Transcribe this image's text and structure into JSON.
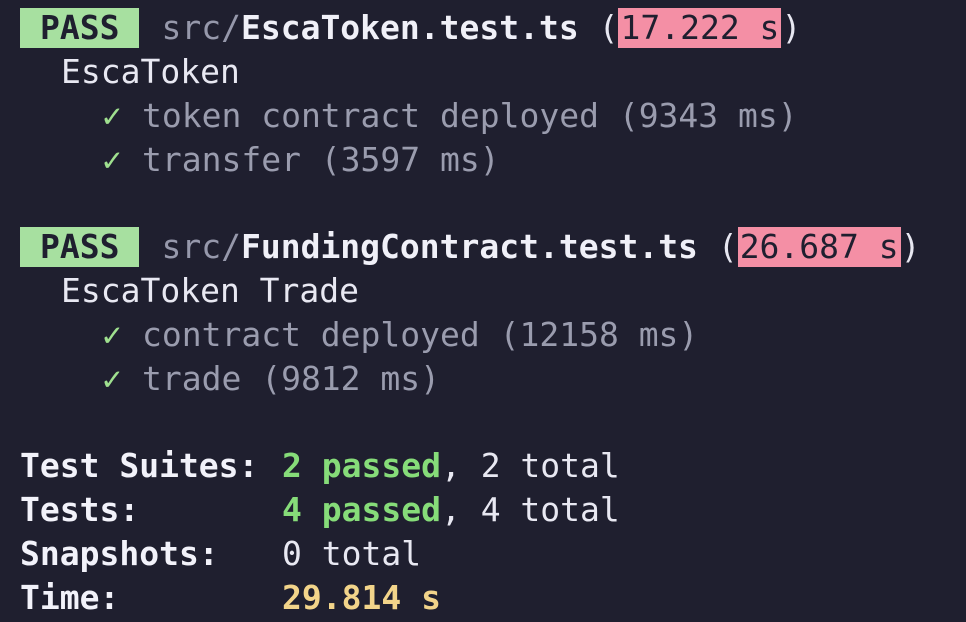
{
  "suites": [
    {
      "status": "PASS",
      "dir": "src/",
      "file": "EscaToken.test.ts",
      "open_paren": "(",
      "duration": "17.222 s",
      "close_paren": ")",
      "name": "EscaToken",
      "tests": [
        {
          "check": "✓",
          "text": "token contract deployed (9343 ms)"
        },
        {
          "check": "✓",
          "text": "transfer (3597 ms)"
        }
      ]
    },
    {
      "status": "PASS",
      "dir": "src/",
      "file": "FundingContract.test.ts",
      "open_paren": "(",
      "duration": "26.687 s",
      "close_paren": ")",
      "name": "EscaToken Trade",
      "tests": [
        {
          "check": "✓",
          "text": "contract deployed (12158 ms)"
        },
        {
          "check": "✓",
          "text": "trade (9812 ms)"
        }
      ]
    }
  ],
  "summary": {
    "suites": {
      "label": "Test Suites:",
      "passed": "2 passed",
      "rest": ", 2 total"
    },
    "tests": {
      "label": "Tests:",
      "passed": "4 passed",
      "rest": ", 4 total"
    },
    "snapshots": {
      "label": "Snapshots:",
      "value": "0 total"
    },
    "time": {
      "label": "Time:",
      "value": "29.814 s"
    }
  },
  "colors": {
    "background": "#1f1f2f",
    "pass_badge": "#a7e0a0",
    "slow_duration": "#f48fa5",
    "passed_text": "#86dc79",
    "time_value": "#f2d48a"
  }
}
